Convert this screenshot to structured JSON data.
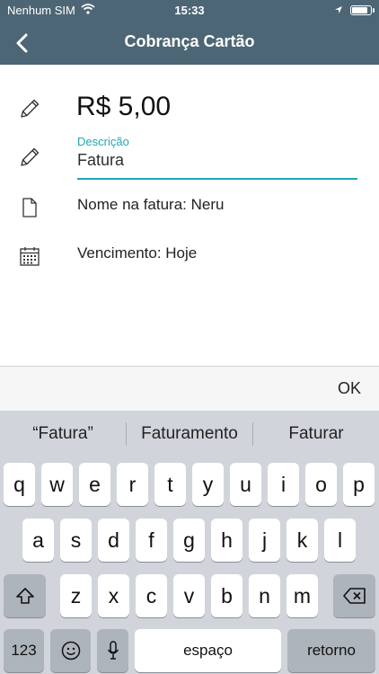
{
  "status": {
    "carrier": "Nenhum SIM",
    "time": "15:33",
    "battery_level": 0.9
  },
  "nav": {
    "title": "Cobrança Cartão"
  },
  "amount": {
    "value": "R$ 5,00"
  },
  "description": {
    "label": "Descrição",
    "value": "Fatura"
  },
  "invoice_name": {
    "text": "Nome na fatura: Neru"
  },
  "due": {
    "text": "Vencimento: Hoje"
  },
  "accessory": {
    "ok_label": "OK"
  },
  "keyboard": {
    "suggestions": [
      "“Fatura”",
      "Faturamento",
      "Faturar"
    ],
    "row1": [
      "q",
      "w",
      "e",
      "r",
      "t",
      "y",
      "u",
      "i",
      "o",
      "p"
    ],
    "row2": [
      "a",
      "s",
      "d",
      "f",
      "g",
      "h",
      "j",
      "k",
      "l"
    ],
    "row3": [
      "z",
      "x",
      "c",
      "v",
      "b",
      "n",
      "m"
    ],
    "numbers_label": "123",
    "space_label": "espaço",
    "return_label": "retorno"
  },
  "colors": {
    "header": "#4c6675",
    "accent": "#22a6b3"
  }
}
